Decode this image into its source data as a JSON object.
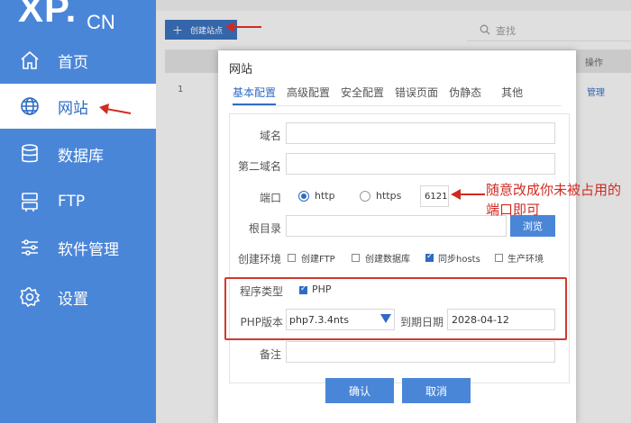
{
  "sidebar": {
    "logo": "XP.",
    "logo_sub": "CN",
    "items": [
      {
        "label": "首页",
        "icon": "home-icon"
      },
      {
        "label": "网站",
        "icon": "globe-icon"
      },
      {
        "label": "数据库",
        "icon": "database-icon"
      },
      {
        "label": "FTP",
        "icon": "server-icon"
      },
      {
        "label": "软件管理",
        "icon": "sliders-icon"
      },
      {
        "label": "设置",
        "icon": "gear-icon"
      }
    ]
  },
  "toolbar": {
    "create_label": "创建站点",
    "search_placeholder": "查找"
  },
  "table": {
    "op_header": "操作",
    "row_num": "1",
    "row_action": "管理"
  },
  "modal": {
    "title": "网站",
    "tabs": [
      "基本配置",
      "高级配置",
      "安全配置",
      "错误页面",
      "伪静态",
      "其他"
    ],
    "labels": {
      "domain": "域名",
      "second_domain": "第二域名",
      "port": "端口",
      "root": "根目录",
      "env": "创建环境",
      "program_type": "程序类型",
      "php_version": "PHP版本",
      "expire": "到期日期",
      "note": "备注"
    },
    "protocol_http": "http",
    "protocol_https": "https",
    "port_value": "6121",
    "browse_label": "浏览",
    "env_options": [
      {
        "label": "创建FTP",
        "checked": false
      },
      {
        "label": "创建数据库",
        "checked": false
      },
      {
        "label": "同步hosts",
        "checked": true
      },
      {
        "label": "生产环境",
        "checked": false
      }
    ],
    "program_php_label": "PHP",
    "php_version_value": "php7.3.4nts",
    "expire_value": "2028-04-12",
    "confirm_label": "确认",
    "cancel_label": "取消"
  },
  "annotation": {
    "text": "随意改成你未被占用的端口即可",
    "color": "#cf2b22"
  },
  "colors": {
    "sidebar": "#4a86d8",
    "accent": "#2e6cc4",
    "annotation": "#cf3a2f"
  }
}
